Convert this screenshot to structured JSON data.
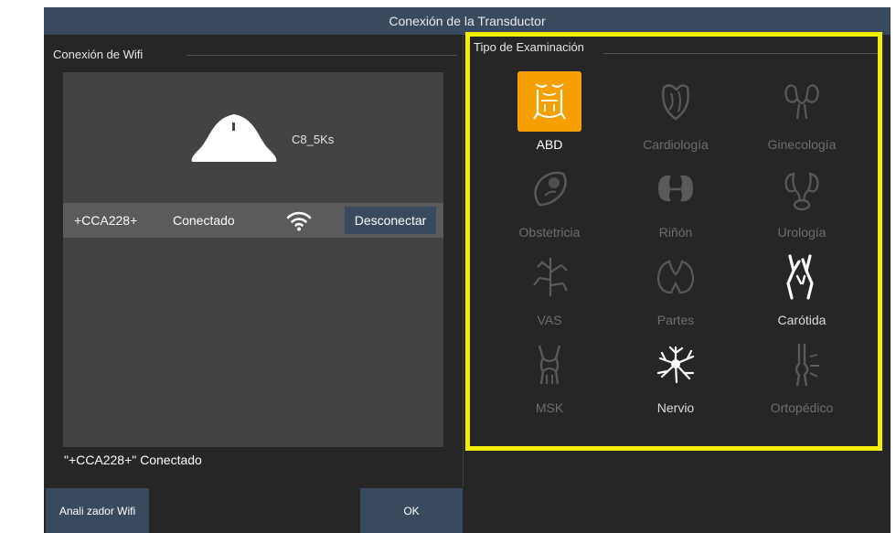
{
  "window": {
    "title": "Conexión de la Transductor"
  },
  "wifi": {
    "legend": "Conexión de Wifi",
    "probe_name": "C8_5Ks",
    "device": {
      "id": "+CCA228+",
      "status": "Conectado",
      "action": "Desconectar"
    },
    "status_message": "\"+CCA228+\" Conectado"
  },
  "exam": {
    "legend": "Tipo de Examinación",
    "items": [
      {
        "label": "ABD",
        "icon": "abdomen-icon",
        "state": "selected"
      },
      {
        "label": "Cardiología",
        "icon": "heart-icon",
        "state": "disabled"
      },
      {
        "label": "Ginecología",
        "icon": "uterus-icon",
        "state": "disabled"
      },
      {
        "label": "Obstetricia",
        "icon": "fetus-icon",
        "state": "disabled"
      },
      {
        "label": "Riñón",
        "icon": "kidney-icon",
        "state": "disabled"
      },
      {
        "label": "Urología",
        "icon": "urinary-icon",
        "state": "disabled"
      },
      {
        "label": "VAS",
        "icon": "vascular-icon",
        "state": "disabled"
      },
      {
        "label": "Partes",
        "icon": "thyroid-icon",
        "state": "disabled"
      },
      {
        "label": "Carótida",
        "icon": "carotid-icon",
        "state": "enabled"
      },
      {
        "label": "MSK",
        "icon": "joint-icon",
        "state": "disabled"
      },
      {
        "label": "Nervio",
        "icon": "nerve-icon",
        "state": "enabled"
      },
      {
        "label": "Ortopédico",
        "icon": "bone-icon",
        "state": "disabled"
      }
    ]
  },
  "buttons": {
    "wifi_analyzer": "Anali zador Wifi",
    "ok": "OK"
  },
  "colors": {
    "title_bar": "#3a4a5e",
    "background": "#262626",
    "panel": "#434343",
    "row": "#5b5b5b",
    "selected": "#f5a000",
    "highlight_frame": "#f2ee07",
    "disabled_text": "#6e6e6e"
  }
}
